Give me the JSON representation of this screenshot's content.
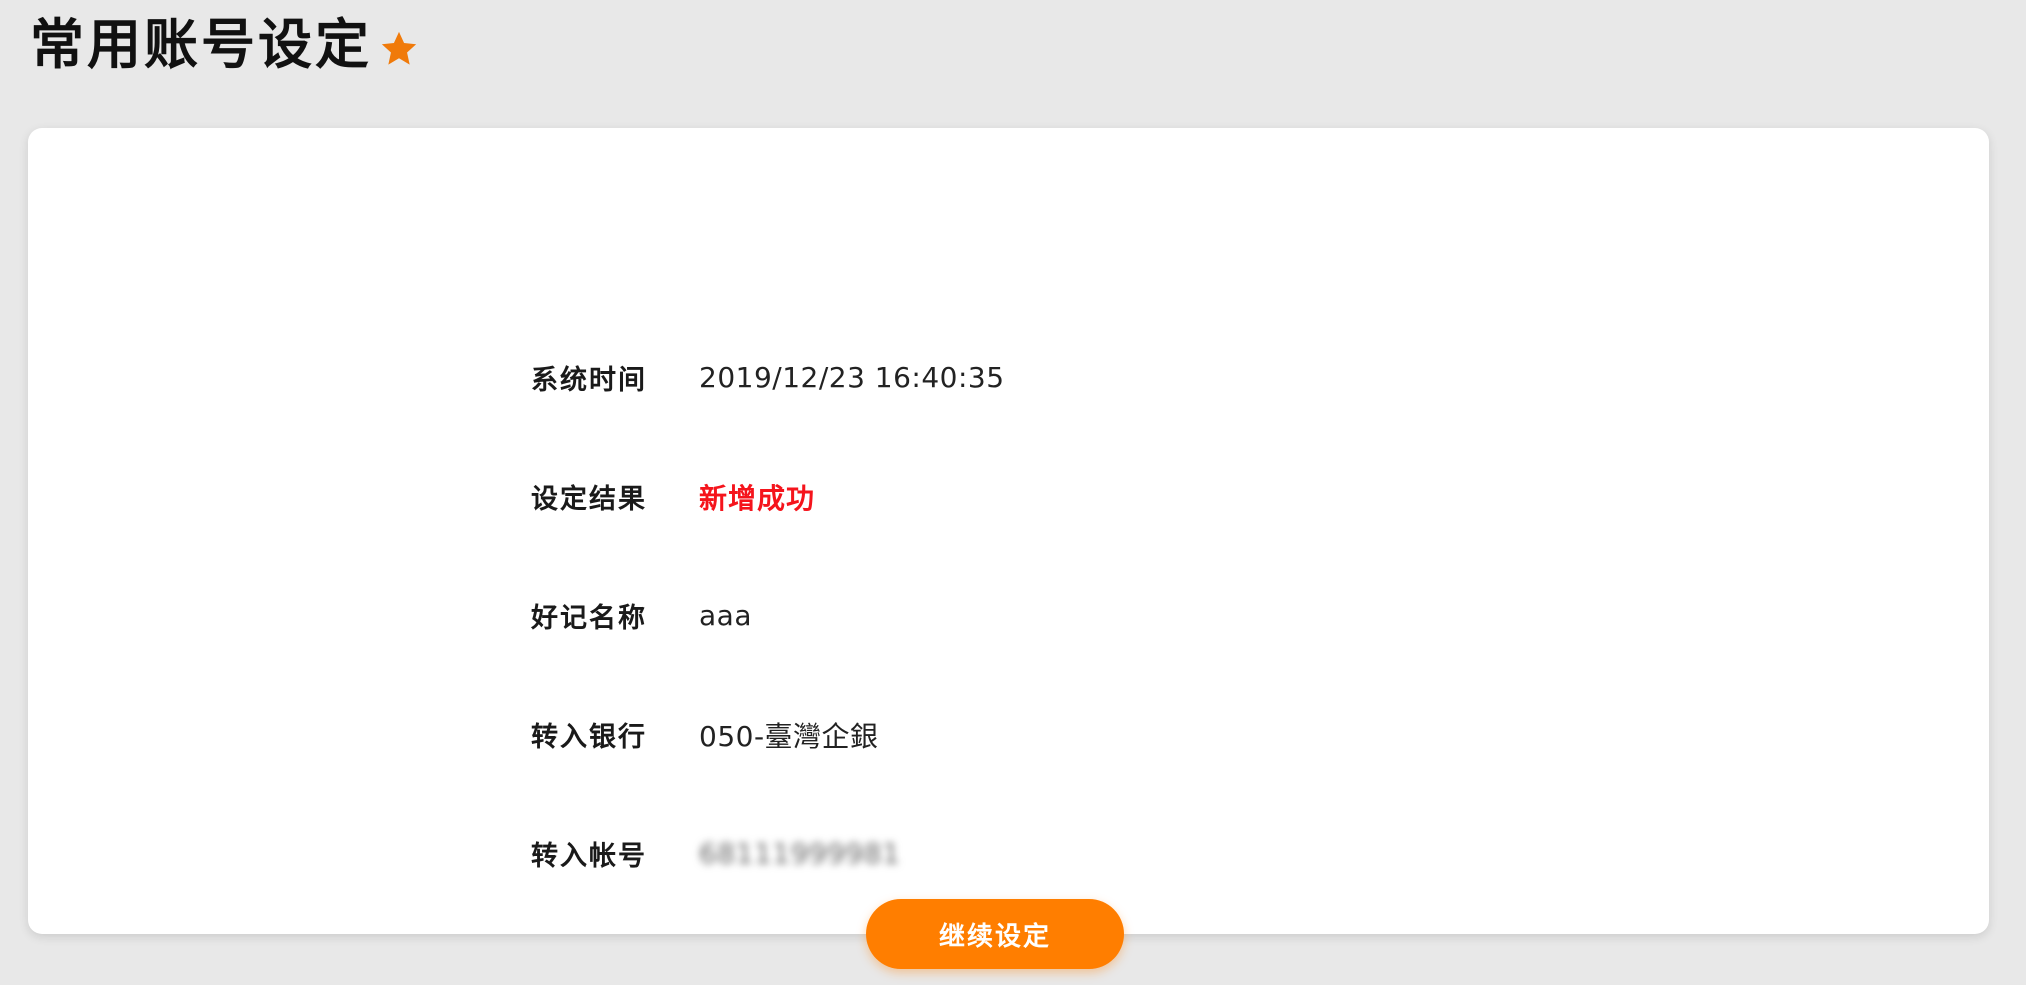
{
  "header": {
    "title": "常用账号设定",
    "favorite_icon": "star-icon",
    "accent_color": "#f07a0a"
  },
  "details": {
    "rows": [
      {
        "label": "系统时间",
        "value": "2019/12/23 16:40:35"
      },
      {
        "label": "设定结果",
        "value": "新增成功"
      },
      {
        "label": "好记名称",
        "value": "aaa"
      },
      {
        "label": "转入银行",
        "value": "050-臺灣企銀"
      },
      {
        "label": "转入帐号",
        "value": "68111999981"
      }
    ],
    "status_color": "#f5141c"
  },
  "actions": {
    "continue_label": "继续设定",
    "button_color": "#ff7e00"
  }
}
